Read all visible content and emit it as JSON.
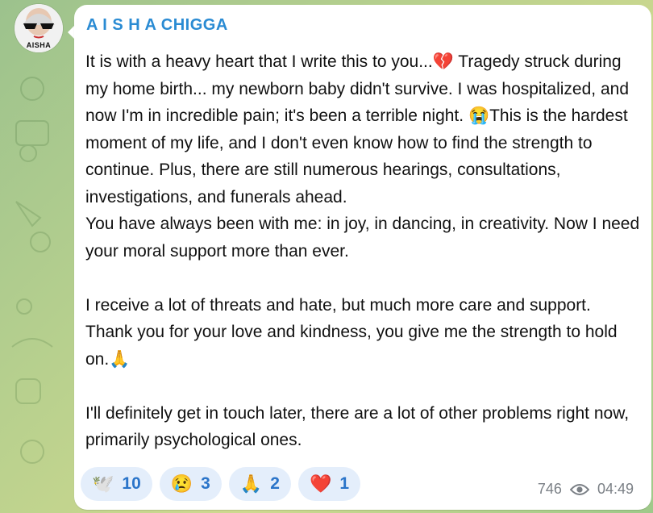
{
  "channel": {
    "sender_name": "A I S H A CHIGGA",
    "avatar_text": "AISHA"
  },
  "message": {
    "paragraphs": [
      "It is with a heavy heart that I write this to you...💔 Tragedy struck during my home birth... my newborn baby didn't survive. I was hospitalized, and now I'm in incredible pain; it's been a terrible night. 😭This is the hardest moment of my life, and I don't even know how to find the strength to continue. Plus, there are still numerous hearings, consultations, investigations, and funerals ahead.",
      "You have always been with me: in joy, in dancing, in creativity. Now I need your moral support more than ever.",
      "",
      "I receive a lot of threats and hate, but much more care and support. Thank you for your love and kindness, you give me the strength to hold on.🙏",
      "",
      "I'll definitely get in touch later, there are a lot of other problems right now, primarily psychological ones."
    ]
  },
  "reactions": [
    {
      "emoji": "🕊️",
      "count": "10"
    },
    {
      "emoji": "😢",
      "count": "3"
    },
    {
      "emoji": "🙏",
      "count": "2"
    },
    {
      "emoji": "❤️",
      "count": "1"
    }
  ],
  "meta": {
    "views": "746",
    "time": "04:49"
  },
  "icons": {
    "views": "eye-icon"
  },
  "colors": {
    "sender": "#2a8bd3",
    "reaction_bg": "#e4eefb",
    "reaction_text": "#2a74c9",
    "meta_text": "#7a7f85"
  }
}
